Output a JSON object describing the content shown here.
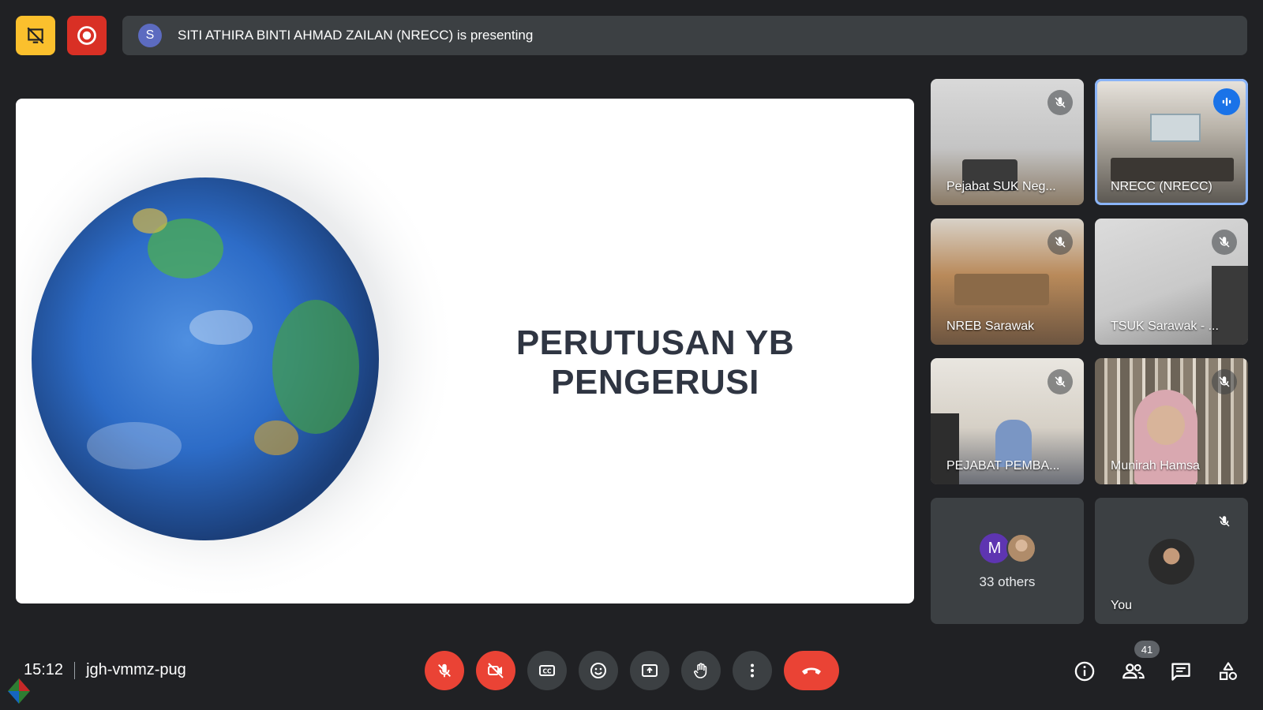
{
  "header": {
    "presenter_initial": "S",
    "presenting_text": "SITI ATHIRA BINTI AHMAD ZAILAN (NRECC) is presenting"
  },
  "slide": {
    "title": "PERUTUSAN YB PENGERUSI"
  },
  "participants": [
    {
      "name": "Pejabat SUK Neg...",
      "muted": true
    },
    {
      "name": "NRECC (NRECC)",
      "muted": false,
      "speaking": true
    },
    {
      "name": "NREB Sarawak",
      "muted": true
    },
    {
      "name": "TSUK Sarawak - ...",
      "muted": true
    },
    {
      "name": "PEJABAT PEMBA...",
      "muted": true
    },
    {
      "name": "Munirah Hamsa",
      "muted": true
    }
  ],
  "others": {
    "initial": "M",
    "label": "33 others"
  },
  "self": {
    "label": "You",
    "muted": true
  },
  "footer": {
    "time": "15:12",
    "meeting_code": "jgh-vmmz-pug",
    "people_count": "41"
  },
  "colors": {
    "background": "#202124",
    "panel": "#3c4043",
    "danger": "#ea4335",
    "accent": "#8ab4f8",
    "warning": "#fbc02d"
  },
  "icons": {
    "no_present": "no-present-icon",
    "record": "record-icon",
    "mic_off": "mic-off-icon",
    "cam_off": "camera-off-icon",
    "captions": "captions-icon",
    "emoji": "emoji-icon",
    "present": "present-screen-icon",
    "hand": "raise-hand-icon",
    "more": "more-vert-icon",
    "end": "call-end-icon",
    "info": "info-icon",
    "people": "people-icon",
    "chat": "chat-icon",
    "activities": "activities-icon"
  }
}
